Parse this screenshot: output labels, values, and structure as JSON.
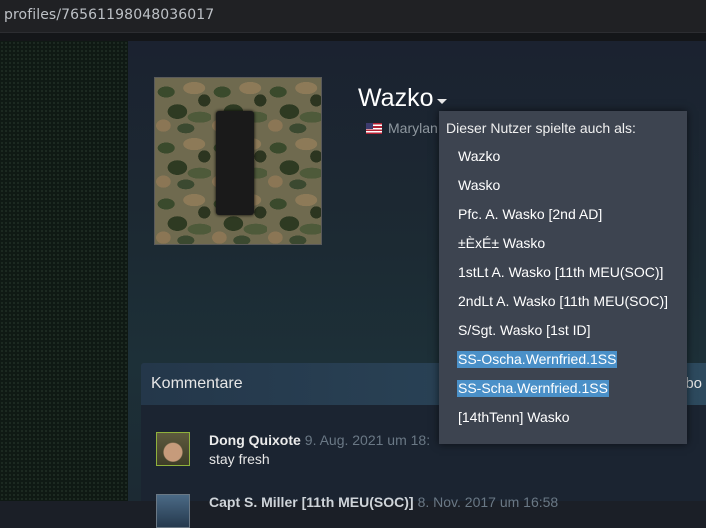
{
  "browser": {
    "url": "profiles/76561198048036017"
  },
  "profile": {
    "name": "Wazko",
    "location": "Marylan",
    "flag_icon": "us-flag-icon"
  },
  "alias_dropdown": {
    "heading": "Dieser Nutzer spielte auch als:",
    "items": [
      {
        "label": "Wazko",
        "selected": false
      },
      {
        "label": "Wasko",
        "selected": false
      },
      {
        "label": "Pfc. A. Wasko [2nd AD]",
        "selected": false
      },
      {
        "label": "±ÈxÉ± Wasko",
        "selected": false
      },
      {
        "label": "1stLt A. Wasko [11th MEU(SOC)]",
        "selected": false
      },
      {
        "label": "2ndLt A. Wasko [11th MEU(SOC)]",
        "selected": false
      },
      {
        "label": "S/Sgt. Wasko [1st ID]",
        "selected": false
      },
      {
        "label": "SS-Oscha.Wernfried.1SS",
        "selected": true
      },
      {
        "label": "SS-Scha.Wernfried.1SS",
        "selected": true
      },
      {
        "label": "[14thTenn] Wasko",
        "selected": false
      }
    ]
  },
  "comments": {
    "title": "Kommentare",
    "right_text": "abo",
    "items": [
      {
        "author": "Dong Quixote",
        "time": "9. Aug. 2021 um 18:",
        "text": "stay fresh"
      },
      {
        "author": "Capt S. Miller [11th MEU(SOC)]",
        "time": "8. Nov. 2017 um 16:58",
        "text": ""
      }
    ]
  },
  "colors": {
    "selection": "#4a90c8",
    "dropdown_bg": "#3d4450",
    "header_accent": "#2d4a5e"
  }
}
